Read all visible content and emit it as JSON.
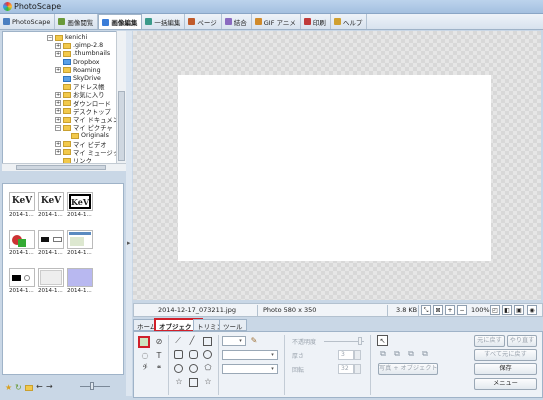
{
  "window": {
    "title": "PhotoScape"
  },
  "tabs": [
    {
      "label": "PhotoScape",
      "color": "#4a7fc1"
    },
    {
      "label": "画像閲覧",
      "color": "#6a9a3a"
    },
    {
      "label": "画像編集",
      "color": "#3b7dd8"
    },
    {
      "label": "一括編集",
      "color": "#3a9a8a"
    },
    {
      "label": "ページ",
      "color": "#c05a2a"
    },
    {
      "label": "結合",
      "color": "#8a6ac0"
    },
    {
      "label": "GIF アニメ",
      "color": "#d08a2a"
    },
    {
      "label": "印刷",
      "color": "#c03a3a"
    },
    {
      "label": "ヘルプ",
      "color": "#d0a030"
    }
  ],
  "active_tab": "画像編集",
  "tree": [
    {
      "label": "kenichi",
      "icon": "user-folder-icon",
      "indent": 0,
      "pm": "−"
    },
    {
      "label": ".gimp-2.8",
      "icon": "folder-icon",
      "indent": 1,
      "pm": "+"
    },
    {
      "label": ".thumbnails",
      "icon": "folder-icon",
      "indent": 1,
      "pm": "+"
    },
    {
      "label": "Dropbox",
      "icon": "dropbox-folder-icon",
      "indent": 1,
      "pm": ""
    },
    {
      "label": "Roaming",
      "icon": "folder-icon",
      "indent": 1,
      "pm": "+"
    },
    {
      "label": "SkyDrive",
      "icon": "skydrive-icon",
      "indent": 1,
      "pm": ""
    },
    {
      "label": "アドレス帳",
      "icon": "contacts-folder-icon",
      "indent": 1,
      "pm": ""
    },
    {
      "label": "お気に入り",
      "icon": "favorites-folder-icon",
      "indent": 1,
      "pm": "+"
    },
    {
      "label": "ダウンロード",
      "icon": "downloads-folder-icon",
      "indent": 1,
      "pm": "+"
    },
    {
      "label": "デスクトップ",
      "icon": "desktop-folder-icon",
      "indent": 1,
      "pm": "+"
    },
    {
      "label": "マイ ドキュメン",
      "icon": "documents-folder-icon",
      "indent": 1,
      "pm": "+"
    },
    {
      "label": "マイ ピクチャ",
      "icon": "pictures-folder-icon",
      "indent": 1,
      "pm": "−"
    },
    {
      "label": "Originals",
      "icon": "folder-icon",
      "indent": 2,
      "pm": ""
    },
    {
      "label": "マイ ビデオ",
      "icon": "videos-folder-icon",
      "indent": 1,
      "pm": "+"
    },
    {
      "label": "マイ ミュージッ",
      "icon": "music-folder-icon",
      "indent": 1,
      "pm": "+"
    },
    {
      "label": "リンク",
      "icon": "links-folder-icon",
      "indent": 1,
      "pm": ""
    },
    {
      "label": "検索",
      "icon": "search-folder-icon",
      "indent": 1,
      "pm": ""
    }
  ],
  "thumbnails": [
    {
      "caption": "2014-1...",
      "kind": "kev1"
    },
    {
      "caption": "2014-1...",
      "kind": "kev2"
    },
    {
      "caption": "2014-1...",
      "kind": "kev3"
    },
    {
      "caption": "2014-1...",
      "kind": "photo-red"
    },
    {
      "caption": "2014-1...",
      "kind": "dark-blocks"
    },
    {
      "caption": "2014-1...",
      "kind": "web-page"
    },
    {
      "caption": "2014-1...",
      "kind": "black-block"
    },
    {
      "caption": "2014-1...",
      "kind": "grey-page"
    },
    {
      "caption": "2014-1...",
      "kind": "lavender"
    }
  ],
  "status": {
    "filename": "2014-12-17_073211.jpg",
    "photo_info": "Photo 580 x 350",
    "filesize": "3.8 KB",
    "zoom": "100%"
  },
  "edit_tabs": [
    "ホーム",
    "オブジェクト",
    "トリミング",
    "ツール"
  ],
  "active_edit_tab": "オブジェクト",
  "tools": {
    "opacity_label": "不透明度",
    "thickness_label": "厚さ",
    "thickness_value": "3",
    "rotation_label": "回転",
    "rotation_value": "32",
    "photo_object_button": "写真 + オブジェクト"
  },
  "right_buttons": {
    "undo": "元に戻す",
    "redo": "やり直す",
    "undo_all": "すべて元に戻す",
    "save": "保存",
    "menu": "メニュー"
  },
  "colors": {
    "highlight_red": "#d0202a",
    "canvas_white": "#ffffff"
  }
}
